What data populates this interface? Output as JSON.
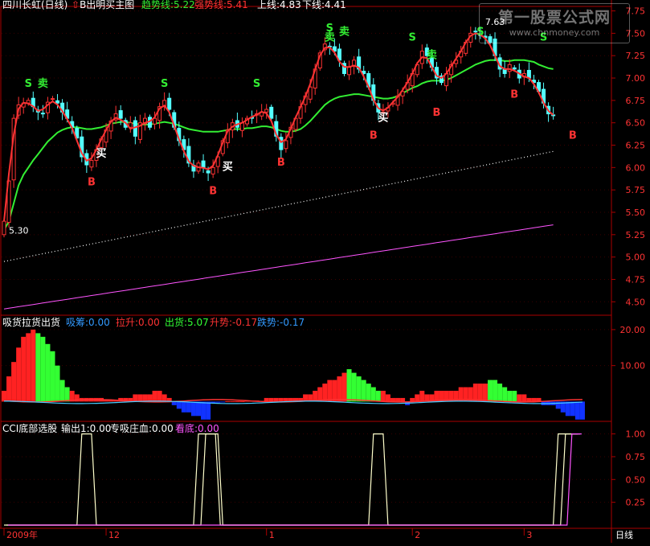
{
  "header": {
    "title": "四川长虹(日线)",
    "indicator_name": "B出明买主图",
    "trend_label": "趋势线:5.22",
    "strong_label": "强势线:5.41",
    "upper_label": "上线:4.83",
    "lower_label": "下线:4.41"
  },
  "watermark": {
    "line1": "第一股票公式网",
    "line2": "www.chnmoney.com"
  },
  "panel2": {
    "title": "吸货拉货出货",
    "items": [
      {
        "label": "吸筹:0.00",
        "color": "#3399ff"
      },
      {
        "label": "拉升:0.00",
        "color": "#ff3333"
      },
      {
        "label": "出货:5.07",
        "color": "#33ff33"
      },
      {
        "label": "升势:-0.17",
        "color": "#ff3333"
      },
      {
        "label": "跌势:-0.17",
        "color": "#3399ff"
      }
    ]
  },
  "panel3": {
    "title": "CCI底部选股",
    "items": [
      {
        "label": "输出1:0.00",
        "color": "#ffffff"
      },
      {
        "label": "专吸庄血:0.00",
        "color": "#ffffff"
      },
      {
        "label": "看底:0.00",
        "color": "#ff55ff"
      }
    ]
  },
  "xaxis": {
    "labels": [
      {
        "text": "2009年",
        "bar": 0
      },
      {
        "text": "12",
        "bar": 21
      },
      {
        "text": "1",
        "bar": 54
      },
      {
        "text": "2",
        "bar": 84
      },
      {
        "text": "3",
        "bar": 107
      }
    ],
    "period": "日线"
  },
  "colors": {
    "up": "#ff3333",
    "down": "#54ffff",
    "trend": "#33ee33",
    "strong": "#ff3333",
    "upper": "#ffffff",
    "lower": "#ff55ff",
    "grid": "#aa0000"
  },
  "chart_data": [
    {
      "type": "candlestick",
      "title": "四川长虹(日线)",
      "ylim": [
        4.35,
        7.8
      ],
      "yticks": [
        4.5,
        4.75,
        5.0,
        5.25,
        5.5,
        5.75,
        6.0,
        6.25,
        6.5,
        6.75,
        7.0,
        7.25,
        7.5,
        7.75
      ],
      "close": [
        5.4,
        5.85,
        6.55,
        6.7,
        6.72,
        6.75,
        6.68,
        6.62,
        6.6,
        6.73,
        6.77,
        6.72,
        6.62,
        6.55,
        6.45,
        6.33,
        6.12,
        6.03,
        6.08,
        6.2,
        6.32,
        6.42,
        6.52,
        6.6,
        6.55,
        6.45,
        6.5,
        6.35,
        6.5,
        6.55,
        6.45,
        6.55,
        6.68,
        6.75,
        6.65,
        6.45,
        6.3,
        6.2,
        6.05,
        5.96,
        6.05,
        6.0,
        5.94,
        6.0,
        6.12,
        6.3,
        6.42,
        6.5,
        6.45,
        6.5,
        6.55,
        6.55,
        6.6,
        6.62,
        6.65,
        6.55,
        6.35,
        6.2,
        6.3,
        6.45,
        6.55,
        6.68,
        6.8,
        6.9,
        7.1,
        7.28,
        7.38,
        7.35,
        7.3,
        7.2,
        7.05,
        7.12,
        7.2,
        7.1,
        7.05,
        6.9,
        6.75,
        6.62,
        6.62,
        6.67,
        6.72,
        6.8,
        6.85,
        6.95,
        7.05,
        7.15,
        7.3,
        7.25,
        7.12,
        7.0,
        6.95,
        7.05,
        7.15,
        7.2,
        7.3,
        7.4,
        7.5,
        7.52,
        7.48,
        7.45,
        7.4,
        7.25,
        7.1,
        7.05,
        7.15,
        7.1,
        7.0,
        7.05,
        7.0,
        6.95,
        6.85,
        6.72,
        6.6,
        6.58
      ],
      "trend_line": [
        5.3,
        5.4,
        5.6,
        5.8,
        5.92,
        6.0,
        6.08,
        6.15,
        6.22,
        6.29,
        6.34,
        6.39,
        6.42,
        6.44,
        6.45,
        6.45,
        6.44,
        6.43,
        6.43,
        6.44,
        6.45,
        6.47,
        6.49,
        6.5,
        6.51,
        6.51,
        6.5,
        6.49,
        6.48,
        6.48,
        6.48,
        6.49,
        6.5,
        6.51,
        6.5,
        6.49,
        6.47,
        6.45,
        6.43,
        6.42,
        6.41,
        6.4,
        6.4,
        6.4,
        6.4,
        6.41,
        6.42,
        6.43,
        6.43,
        6.43,
        6.44,
        6.44,
        6.45,
        6.46,
        6.46,
        6.45,
        6.43,
        6.41,
        6.4,
        6.4,
        6.41,
        6.43,
        6.47,
        6.52,
        6.58,
        6.64,
        6.7,
        6.74,
        6.77,
        6.79,
        6.8,
        6.81,
        6.82,
        6.82,
        6.81,
        6.8,
        6.79,
        6.78,
        6.77,
        6.77,
        6.78,
        6.8,
        6.83,
        6.86,
        6.89,
        6.91,
        6.94,
        6.96,
        6.97,
        6.97,
        6.97,
        6.98,
        7.0,
        7.03,
        7.06,
        7.09,
        7.12,
        7.15,
        7.17,
        7.19,
        7.2,
        7.2,
        7.2,
        7.19,
        7.19,
        7.2,
        7.2,
        7.2,
        7.19,
        7.18,
        7.15,
        7.13,
        7.11,
        7.1
      ],
      "upper_line": {
        "start": 4.95,
        "end": 6.18
      },
      "lower_line": {
        "start": 4.42,
        "end": 5.36
      },
      "markers": [
        {
          "text": "S",
          "bar": 5,
          "price": 6.9,
          "color": "#33ee33"
        },
        {
          "text": "卖",
          "bar": 8,
          "price": 6.9,
          "color": "#33ee33"
        },
        {
          "text": "S",
          "bar": 33,
          "price": 6.9,
          "color": "#33ee33"
        },
        {
          "text": "S",
          "bar": 52,
          "price": 6.9,
          "color": "#33ee33"
        },
        {
          "text": "S",
          "bar": 67,
          "price": 7.52,
          "color": "#33ee33"
        },
        {
          "text": "卖",
          "bar": 67,
          "price": 7.42,
          "color": "#33ee33"
        },
        {
          "text": "卖",
          "bar": 70,
          "price": 7.48,
          "color": "#33ee33"
        },
        {
          "text": "S",
          "bar": 84,
          "price": 7.42,
          "color": "#33ee33"
        },
        {
          "text": "卖",
          "bar": 88,
          "price": 7.22,
          "color": "#33ee33"
        },
        {
          "text": "S",
          "bar": 98,
          "price": 7.48,
          "color": "#33ee33"
        },
        {
          "text": "S",
          "bar": 111,
          "price": 7.42,
          "color": "#33ee33"
        },
        {
          "text": "买",
          "bar": 20,
          "price": 6.12,
          "color": "#ffffff"
        },
        {
          "text": "买",
          "bar": 46,
          "price": 5.97,
          "color": "#ffffff"
        },
        {
          "text": "买",
          "bar": 78,
          "price": 6.52,
          "color": "#ffffff"
        },
        {
          "text": "B",
          "bar": 18,
          "price": 5.8,
          "color": "#ff3333"
        },
        {
          "text": "B",
          "bar": 43,
          "price": 5.7,
          "color": "#ff3333"
        },
        {
          "text": "B",
          "bar": 57,
          "price": 6.02,
          "color": "#ff3333"
        },
        {
          "text": "B",
          "bar": 76,
          "price": 6.32,
          "color": "#ff3333"
        },
        {
          "text": "B",
          "bar": 89,
          "price": 6.58,
          "color": "#ff3333"
        },
        {
          "text": "B",
          "bar": 105,
          "price": 6.78,
          "color": "#ff3333"
        },
        {
          "text": "B",
          "bar": 117,
          "price": 6.32,
          "color": "#ff3333"
        }
      ],
      "price_labels": [
        {
          "text": "5.30",
          "bar": 0,
          "price": 5.3
        },
        {
          "text": "7.63",
          "bar": 98,
          "price": 7.63
        }
      ]
    },
    {
      "type": "bar",
      "title": "吸货拉货出货",
      "ylim": [
        -5.5,
        24
      ],
      "yticks": [
        10.0,
        20.0
      ],
      "values": [
        3,
        7,
        11,
        15,
        18,
        19,
        20,
        19,
        18,
        16,
        14,
        10,
        6,
        4,
        3,
        2,
        1,
        1,
        1,
        1,
        1,
        0.5,
        0.5,
        0.5,
        1,
        1,
        1,
        2,
        2,
        2,
        2,
        3,
        3,
        2,
        1,
        -1,
        -2,
        -3,
        -3,
        -4,
        -4,
        -5,
        -5,
        -0.5,
        -0.3,
        -0.2,
        0.1,
        0.1,
        0.1,
        0.1,
        0.2,
        0.3,
        0.3,
        0.2,
        1,
        1,
        1,
        1,
        1,
        1,
        1,
        1,
        2,
        2,
        3,
        4,
        5,
        6,
        6,
        7,
        8,
        9,
        8,
        7,
        6,
        5,
        4,
        3,
        3,
        2,
        1,
        1,
        1,
        -1,
        1,
        2,
        3,
        2,
        2,
        3,
        3,
        3,
        3,
        3,
        4,
        4,
        4,
        5,
        5,
        5,
        6,
        6,
        5,
        4,
        3,
        3,
        2,
        2,
        1,
        1,
        1,
        -1,
        -1,
        -1,
        -2,
        -3,
        -4,
        -4,
        -5,
        -5
      ]
    },
    {
      "type": "line",
      "title": "CCI底部选股",
      "ylim": [
        0,
        1.12
      ],
      "yticks": [
        0.25,
        0.5,
        0.75,
        1.0
      ],
      "output1": [
        0,
        0,
        0,
        0,
        0,
        0,
        0,
        0,
        0,
        0,
        0,
        0,
        0,
        0,
        0,
        0,
        1,
        1,
        1,
        0,
        0,
        0,
        0,
        0,
        0,
        0,
        0,
        0,
        0,
        0,
        0,
        0,
        0,
        0,
        0,
        0,
        0,
        0,
        0,
        0,
        1,
        1,
        1,
        1,
        1,
        0,
        0,
        0,
        0,
        0,
        0,
        0,
        0,
        0,
        0,
        0,
        0,
        0,
        0,
        0,
        0,
        0,
        0,
        0,
        0,
        0,
        0,
        0,
        0,
        0,
        0,
        0,
        0,
        0,
        0,
        0,
        1,
        1,
        1,
        0,
        0,
        0,
        0,
        0,
        0,
        0,
        0,
        0,
        0,
        0,
        0,
        0,
        0,
        0,
        0,
        0,
        0,
        0,
        0,
        0,
        0,
        0,
        0,
        0,
        0,
        0,
        0,
        0,
        0,
        0,
        0,
        0,
        0,
        0,
        1,
        1,
        1,
        1,
        1
      ],
      "output2": [
        0,
        0,
        0,
        0,
        0,
        0,
        0,
        0,
        0,
        0,
        0,
        0,
        0,
        0,
        0,
        0,
        0,
        0,
        0,
        0,
        0,
        0,
        0,
        0,
        0,
        0,
        0,
        0,
        0,
        0,
        0,
        0,
        0,
        0,
        0,
        0,
        0,
        0,
        0,
        0,
        0,
        1,
        1,
        1,
        0,
        0,
        0,
        0,
        0,
        0,
        0,
        0,
        0,
        0,
        0,
        0,
        0,
        0,
        0,
        0,
        0,
        0,
        0,
        0,
        0,
        0,
        0,
        0,
        0,
        0,
        0,
        0,
        0,
        0,
        0,
        0,
        0,
        0,
        0,
        0,
        0,
        0,
        0,
        0,
        0,
        0,
        0,
        0,
        0,
        0,
        0,
        0,
        0,
        0,
        0,
        0,
        0,
        0,
        0,
        0,
        0,
        0,
        0,
        0,
        0,
        0,
        0,
        0,
        0,
        0,
        0,
        0,
        0,
        0,
        0,
        1,
        1,
        1,
        1
      ],
      "bottom": [
        0,
        0,
        0,
        0,
        0,
        0,
        0,
        0,
        0,
        0,
        0,
        0,
        0,
        0,
        0,
        0,
        0,
        0,
        0,
        0,
        0,
        0,
        0,
        0,
        0,
        0,
        0,
        0,
        0,
        0,
        0,
        0,
        0,
        0,
        0,
        0,
        0,
        0,
        0,
        0,
        0,
        0,
        0,
        0,
        0,
        0,
        0,
        0,
        0,
        0,
        0,
        0,
        0,
        0,
        0,
        0,
        0,
        0,
        0,
        0,
        0,
        0,
        0,
        0,
        0,
        0,
        0,
        0,
        0,
        0,
        0,
        0,
        0,
        0,
        0,
        0,
        0,
        0,
        0,
        0,
        0,
        0,
        0,
        0,
        0,
        0,
        0,
        0,
        0,
        0,
        0,
        0,
        0,
        0,
        0,
        0,
        0,
        0,
        0,
        0,
        0,
        0,
        0,
        0,
        0,
        0,
        0,
        0,
        0,
        0,
        0,
        0,
        0,
        0,
        0,
        0,
        1,
        1,
        1
      ]
    }
  ]
}
